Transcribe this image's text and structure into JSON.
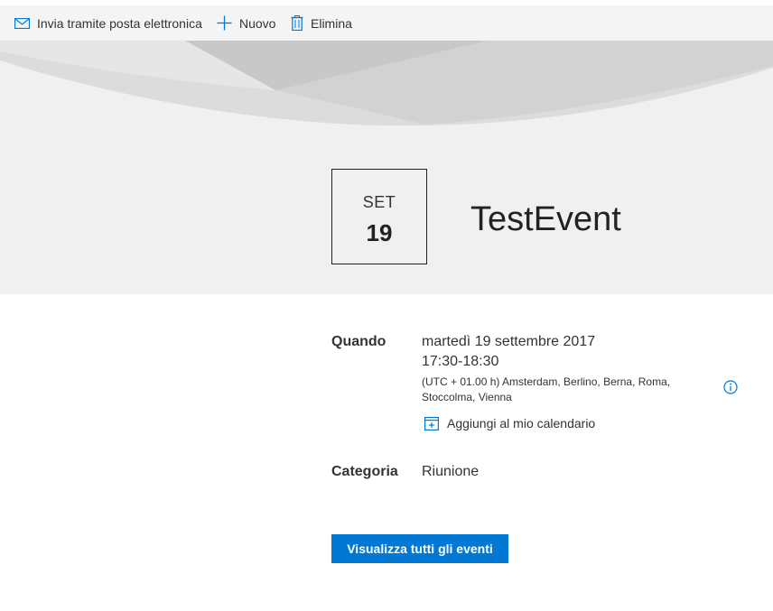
{
  "toolbar": {
    "email_label": "Invia tramite posta elettronica",
    "new_label": "Nuovo",
    "delete_label": "Elimina"
  },
  "event": {
    "month": "SET",
    "day": "19",
    "title": "TestEvent"
  },
  "details": {
    "when_label": "Quando",
    "date": "martedì 19 settembre 2017",
    "time": "17:30-18:30",
    "timezone_line1": "(UTC + 01.00 h) Amsterdam, Berlino, Berna, Roma,",
    "timezone_line2": "Stoccolma, Vienna",
    "add_calendar": "Aggiungi al mio calendario",
    "category_label": "Categoria",
    "category": "Riunione"
  },
  "actions": {
    "view_all": "Visualizza tutti gli eventi"
  },
  "colors": {
    "accent": "#0078d4",
    "hero_bg": "#f0f0f0",
    "cmdbar_bg": "#f4f4f4"
  }
}
